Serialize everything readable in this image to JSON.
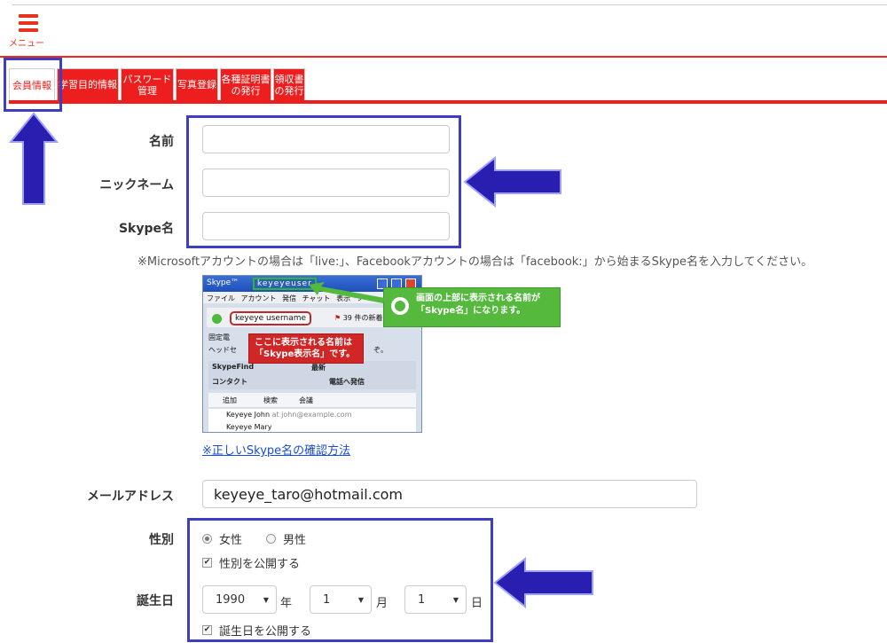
{
  "header": {
    "menu_label": "メニュー"
  },
  "tabs": [
    {
      "label": "会員情報",
      "active": true
    },
    {
      "label": "学習目的情報"
    },
    {
      "label": "パスワード\n管理"
    },
    {
      "label": "写真登録"
    },
    {
      "label": "各種証明書\nの発行"
    },
    {
      "label": "領収書\nの発行"
    }
  ],
  "form": {
    "name_label": "名前",
    "name_value": "",
    "nickname_label": "ニックネーム",
    "nickname_value": "",
    "skype_label": "Skype名",
    "skype_value": "",
    "skype_note": "※Microsoftアカウントの場合は「live:」、Facebookアカウントの場合は「facebook:」から始まるSkype名を入力してください。",
    "skype_help_link": "※正しいSkype名の確認方法",
    "email_label": "メールアドレス",
    "email_value": "keyeye_taro@hotmail.com",
    "gender_label": "性別",
    "gender_female": "女性",
    "gender_male": "男性",
    "gender_public_label": "性別を公開する",
    "birthday_label": "誕生日",
    "birth_year": "1990",
    "birth_year_unit": "年",
    "birth_month": "1",
    "birth_month_unit": "月",
    "birth_day": "1",
    "birth_day_unit": "日",
    "birthday_public_label": "誕生日を公開する"
  },
  "skype_screenshot": {
    "window_title": "Skype™",
    "title_username": "keyeyeuser",
    "menu": "ファイル アカウント 発信 チャット 表示 ツ",
    "display_name": "keyeye username",
    "unread": "39 件の新着",
    "row1": "固定電",
    "row2": "ヘッドセ",
    "row2_tail": "ぞ。",
    "tab_skypefind": "SkypeFind",
    "tab_news": "最新",
    "tab_contacts": "コンタクト",
    "tab_call": "電話へ発信",
    "tool_add": "追加",
    "tool_search": "検索",
    "tool_meeting": "会議",
    "contact1_name": "Keyeye John",
    "contact1_email": "at john@example.com",
    "contact2_name": "Keyeye Mary",
    "callout_red": "ここに表示される名前は\n「Skype表示名」です。",
    "callout_green": "画面の上部に表示される名前が\n「Skype名」になります。"
  },
  "colors": {
    "accent_red": "#ec1e1e",
    "highlight_blue": "#3d3fc0",
    "link_blue": "#1a4dcc"
  }
}
